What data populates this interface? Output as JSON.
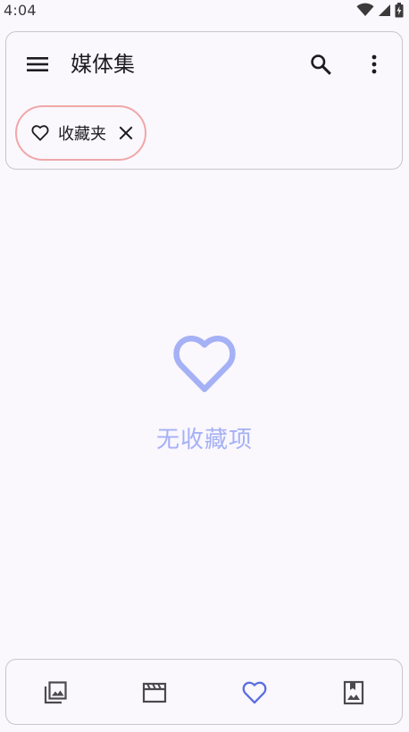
{
  "status_bar": {
    "time": "4:04",
    "icons": [
      "wifi-icon",
      "cell-signal-icon",
      "battery-icon"
    ]
  },
  "app_bar": {
    "title": "媒体集",
    "menu_icon": "hamburger-menu-icon",
    "search_icon": "search-icon",
    "more_icon": "more-vertical-icon"
  },
  "filter_chip": {
    "label": "收藏夹",
    "icon": "heart-outline-icon",
    "close_icon": "close-icon",
    "border_color": "#f0a7a8"
  },
  "empty_state": {
    "icon": "heart-outline-icon",
    "text": "无收藏项",
    "color": "#a5b1f5"
  },
  "bottom_nav": {
    "items": [
      {
        "icon": "photo-library-icon",
        "active": false
      },
      {
        "icon": "movie-icon",
        "active": false
      },
      {
        "icon": "heart-outline-icon",
        "active": true
      },
      {
        "icon": "photo-album-icon",
        "active": false
      }
    ],
    "active_color": "#5b6fe0",
    "inactive_color": "#4a4a4e"
  }
}
